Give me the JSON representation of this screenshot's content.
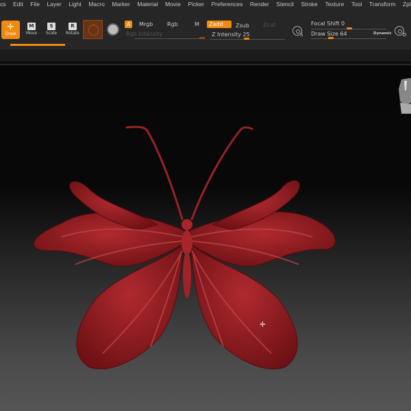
{
  "menu": [
    "cs",
    "Edit",
    "File",
    "Layer",
    "Light",
    "Macro",
    "Marker",
    "Material",
    "Movie",
    "Picker",
    "Preferences",
    "Render",
    "Stencil",
    "Stroke",
    "Texture",
    "Tool",
    "Transform",
    "Zpl"
  ],
  "tools": {
    "draw": "Draw",
    "move": "Move",
    "scale": "Scale",
    "rotate": "Rotate",
    "move_key": "M",
    "scale_key": "S",
    "rotate_key": "R"
  },
  "color_modes": {
    "a": "A",
    "mrgb": "Mrgb",
    "rgb": "Rgb",
    "m": "M",
    "rgb_intensity": "Rgb Intensity"
  },
  "z_modes": {
    "zadd": "Zadd",
    "zsub": "Zsub",
    "zcut": "Zcut",
    "z_intensity": "Z Intensity 25"
  },
  "brush": {
    "focal_shift": "Focal Shift 0",
    "draw_size": "Draw Size 64",
    "dynamic": "Dynamic",
    "s_label": "S",
    "d_label": "D"
  },
  "sliders": {
    "z_intensity": 25,
    "focal_shift": 0,
    "draw_size": 64
  },
  "colors": {
    "accent": "#f08a10",
    "model": "#8b1a1e"
  }
}
